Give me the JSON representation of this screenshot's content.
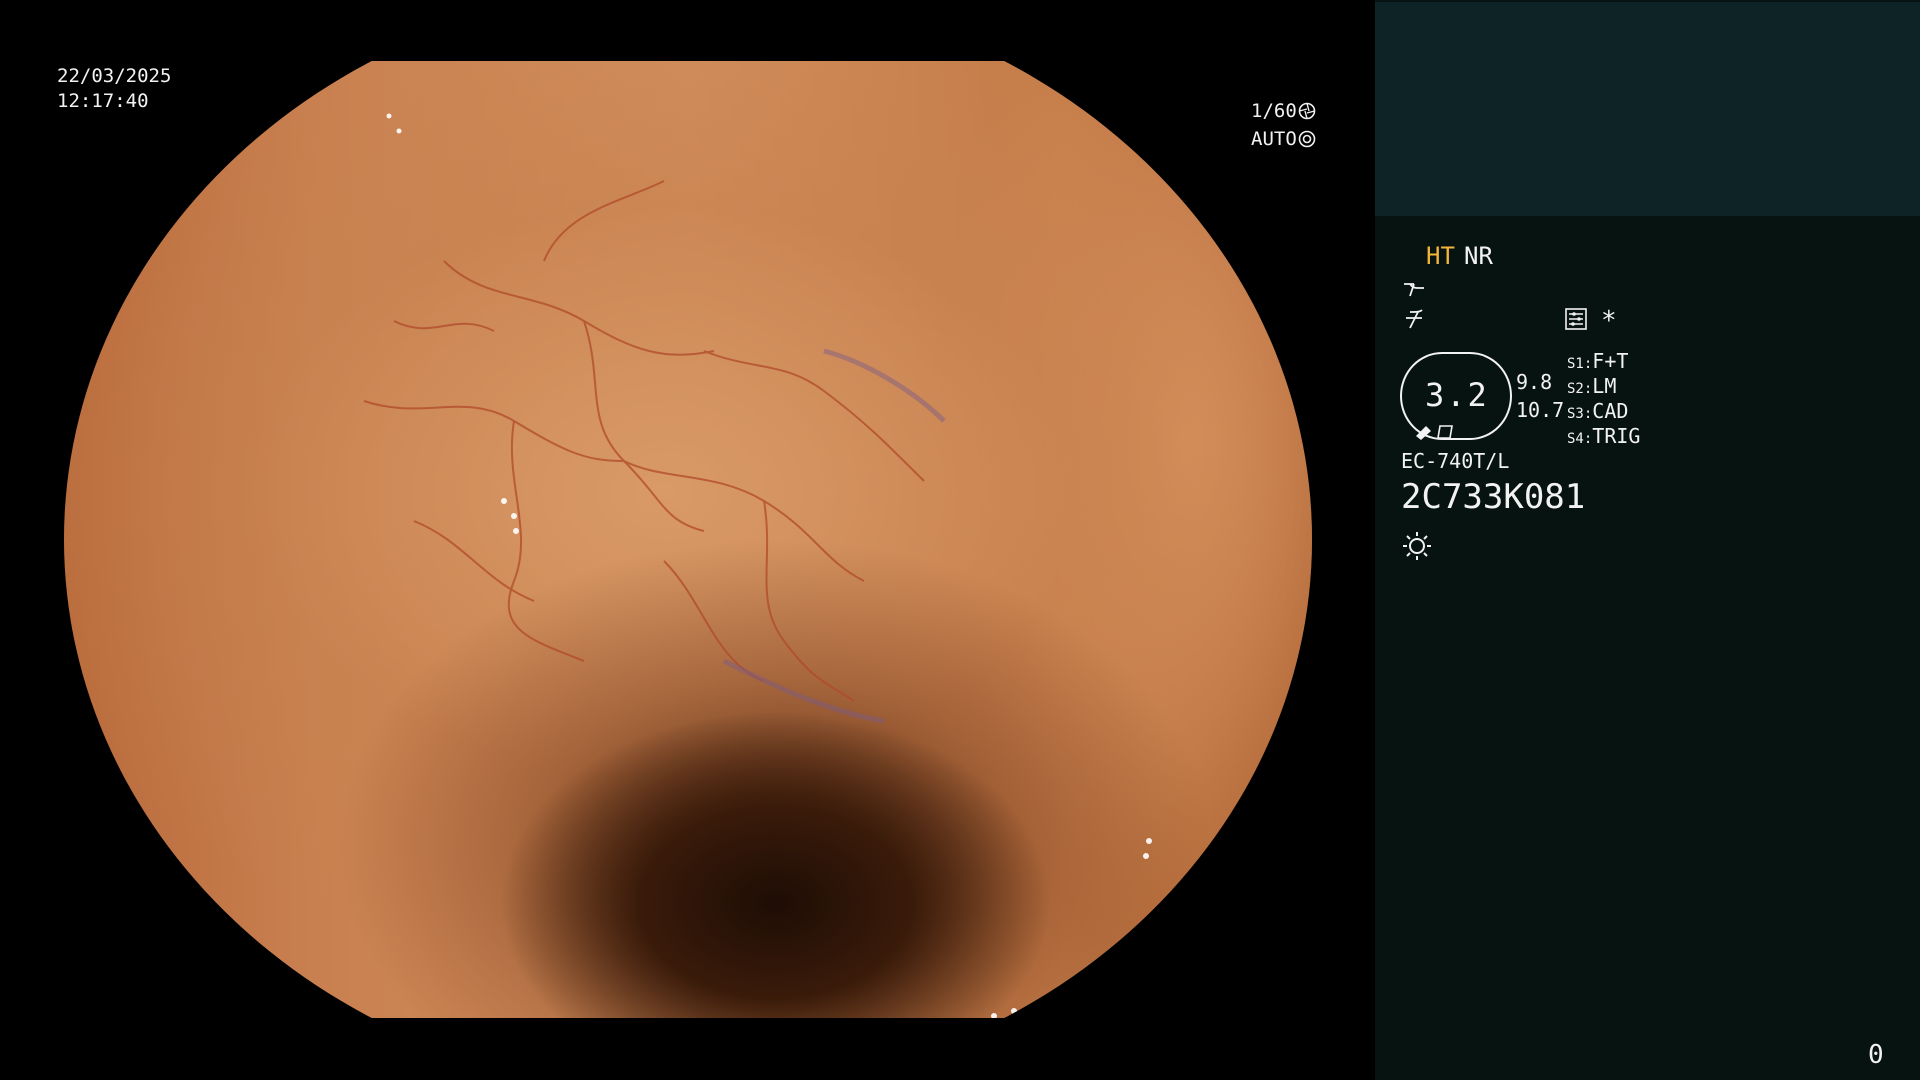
{
  "osd": {
    "date": "22/03/2025",
    "time": "12:17:40",
    "shutter": "1/60",
    "iris_mode": "AUTO",
    "shutter_icon": "aperture-icon",
    "iris_icon": "iris-icon"
  },
  "panel": {
    "ht_label": "HT",
    "nr_label": "NR",
    "enhance_icon": "structure-enhance-icon",
    "tone_icon": "color-tone-icon",
    "menu_icon": "settings-list-icon",
    "asterisk": "*",
    "zoom_value": "3.2",
    "value_top": "9.8",
    "value_bottom": "10.7",
    "switches": [
      {
        "key": "S1",
        "value": "F+T"
      },
      {
        "key": "S2",
        "value": "LM"
      },
      {
        "key": "S3",
        "value": "CAD"
      },
      {
        "key": "S4",
        "value": "TRIG"
      }
    ],
    "scope_model": "EC-740T/L",
    "scope_serial": "2C733K081",
    "light_icon": "light-source-icon",
    "counter": "0"
  },
  "colors": {
    "panel_bg": "#071311",
    "thumb_bg": "#0e2325",
    "accent_yellow": "#f3b43a",
    "text": "#f2f2f2"
  }
}
